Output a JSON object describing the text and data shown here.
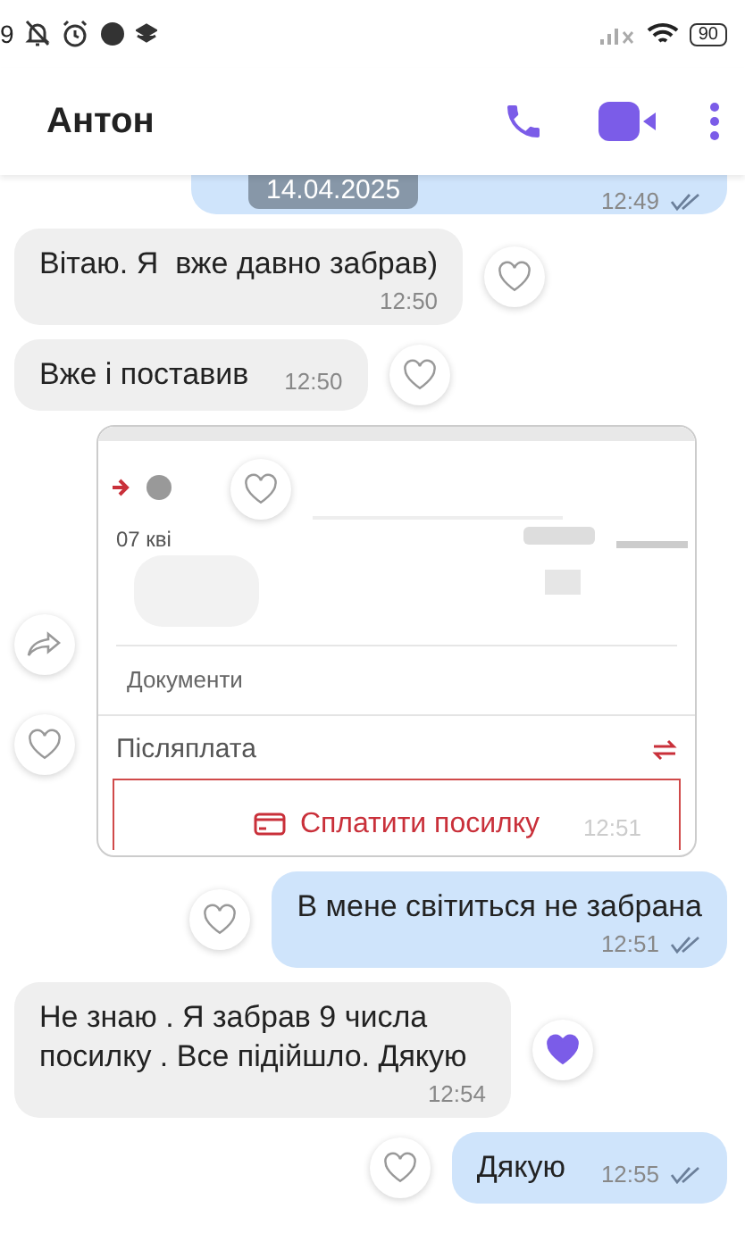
{
  "status_bar": {
    "time": "9",
    "battery": "90"
  },
  "header": {
    "name": "Антон"
  },
  "date_chip": "14.04.2025",
  "messages": [
    {
      "kind": "cut",
      "outgoing": true,
      "time": "12:49",
      "read": true
    },
    {
      "kind": "text",
      "outgoing": false,
      "text": "Вітаю. Я  вже давно забрав)",
      "time": "12:50",
      "liked": false
    },
    {
      "kind": "text",
      "outgoing": false,
      "text": "Вже і поставив",
      "time": "12:50",
      "liked": false,
      "inline": true
    },
    {
      "outgoing": false,
      "time": "12:51",
      "liked": false,
      "date_text": "07 кві",
      "docs": "Документи",
      "cod": "Післяплата",
      "pay": "Сплатити посилку"
    },
    {
      "kind": "text",
      "outgoing": true,
      "text": "В мене світиться не забрана",
      "time": "12:51",
      "liked": false,
      "read": true
    },
    {
      "kind": "text",
      "outgoing": false,
      "text": "Не знаю . Я забрав 9 числа посилку . Все підійшло. Дякую",
      "time": "12:54",
      "liked": true
    },
    {
      "kind": "text",
      "outgoing": true,
      "text": "Дякую",
      "time": "12:55",
      "liked": false,
      "read": true,
      "inline": true
    }
  ]
}
